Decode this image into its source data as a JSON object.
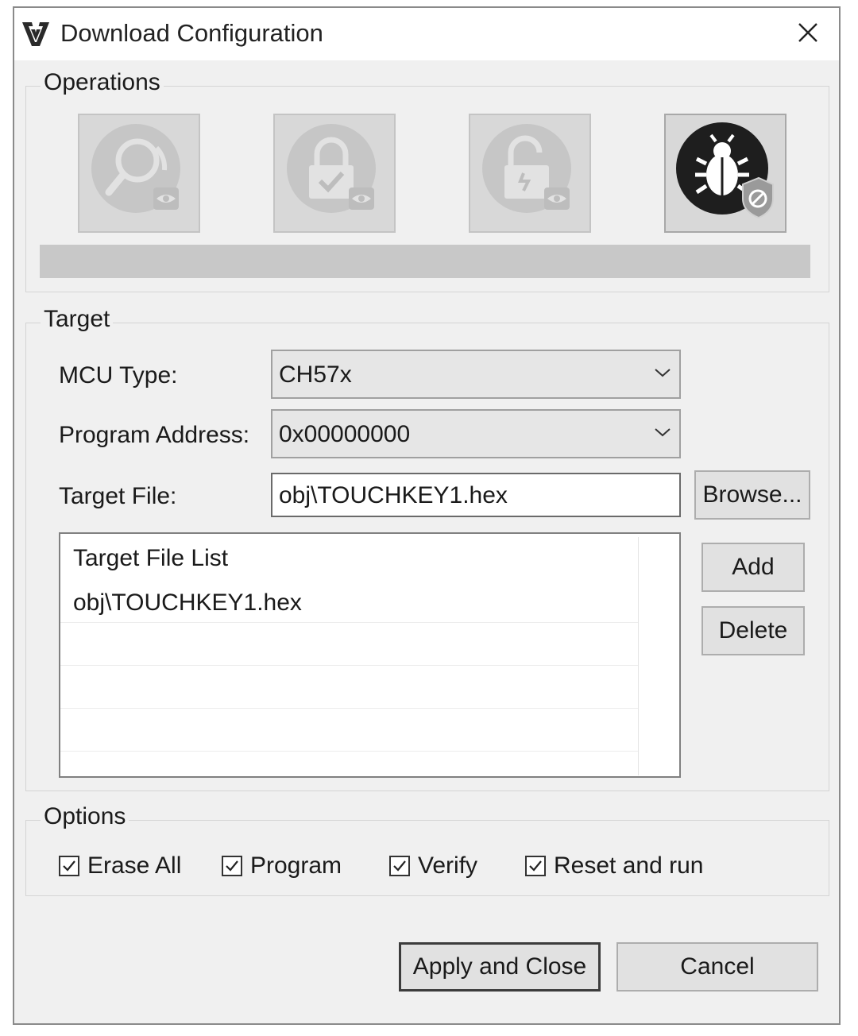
{
  "window": {
    "title": "Download Configuration",
    "close_glyph": "✕"
  },
  "operations": {
    "legend": "Operations",
    "buttons": [
      {
        "icon": "query-icon",
        "enabled": false
      },
      {
        "icon": "lock-icon",
        "enabled": false
      },
      {
        "icon": "unlock-icon",
        "enabled": false
      },
      {
        "icon": "disable-debug-icon",
        "enabled": true
      }
    ],
    "progress": 0
  },
  "target": {
    "legend": "Target",
    "mcu_type_label": "MCU Type:",
    "mcu_type_value": "CH57x",
    "program_address_label": "Program Address:",
    "program_address_value": "0x00000000",
    "target_file_label": "Target File:",
    "target_file_value": "obj\\TOUCHKEY1.hex",
    "browse_label": "Browse...",
    "list_header": "Target File List",
    "list_items": [
      "obj\\TOUCHKEY1.hex"
    ],
    "add_label": "Add",
    "delete_label": "Delete"
  },
  "options": {
    "legend": "Options",
    "erase_all": {
      "label": "Erase All",
      "checked": true
    },
    "program": {
      "label": "Program",
      "checked": true
    },
    "verify": {
      "label": "Verify",
      "checked": true
    },
    "reset_and_run": {
      "label": "Reset and run",
      "checked": true
    }
  },
  "footer": {
    "apply_label": "Apply and Close",
    "cancel_label": "Cancel"
  }
}
